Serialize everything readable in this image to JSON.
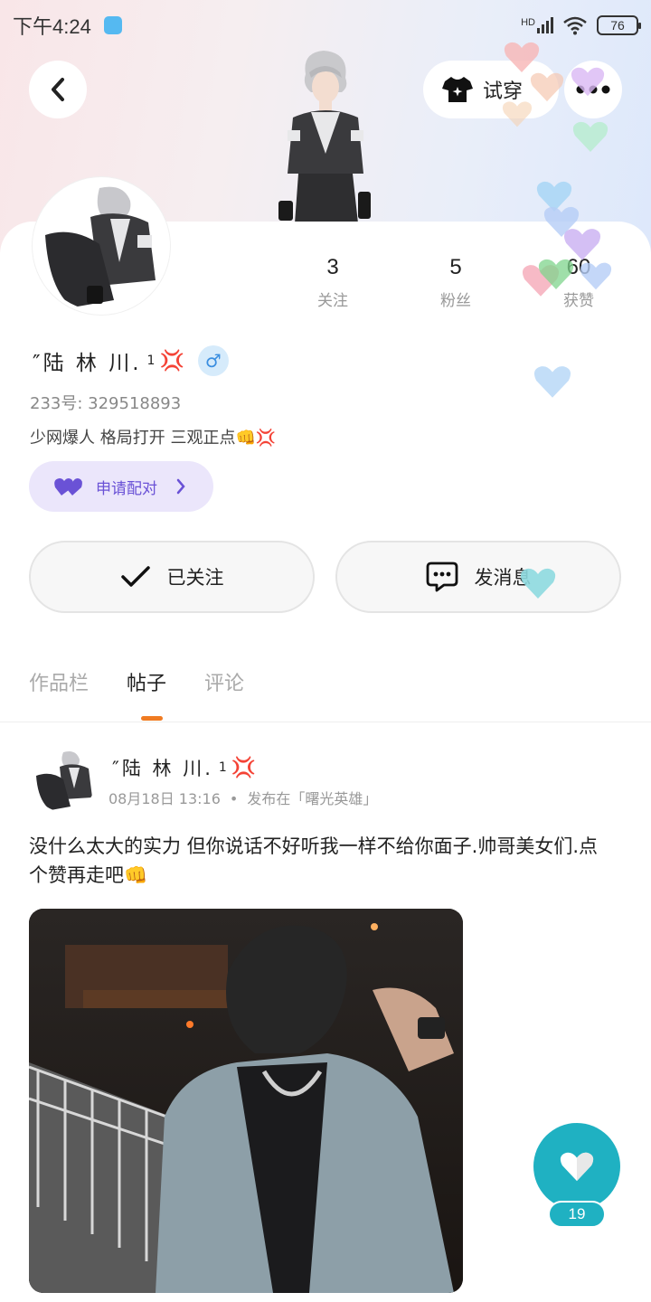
{
  "status_bar": {
    "time": "下午4:24",
    "network": "HD",
    "battery": "76"
  },
  "header": {
    "tryon_label": "试穿"
  },
  "profile": {
    "stats": [
      {
        "value": "3",
        "label": "关注"
      },
      {
        "value": "5",
        "label": "粉丝"
      },
      {
        "value": "60",
        "label": "获赞"
      }
    ],
    "username": "″陆 林 川.",
    "level": "1",
    "uid": "233号: 329518893",
    "bio": "少网爆人 格局打开 三观正点👊💢",
    "pair_label": "申请配对",
    "follow_label": "已关注",
    "message_label": "发消息"
  },
  "tabs": [
    {
      "label": "作品栏",
      "active": false
    },
    {
      "label": "帖子",
      "active": true
    },
    {
      "label": "评论",
      "active": false
    }
  ],
  "post": {
    "author": "″陆 林 川.",
    "level": "1",
    "date": "08月18日 13:16",
    "published_in": "发布在「曙光英雄」",
    "text": "没什么太大的实力 但你说话不好听我一样不给你面子.帅哥美女们.点个赞再走吧👊",
    "like_count": "19"
  },
  "colors": {
    "accent_orange": "#f07b22",
    "like_teal": "#1fb1c2",
    "pair_purple": "#6a52d6"
  }
}
